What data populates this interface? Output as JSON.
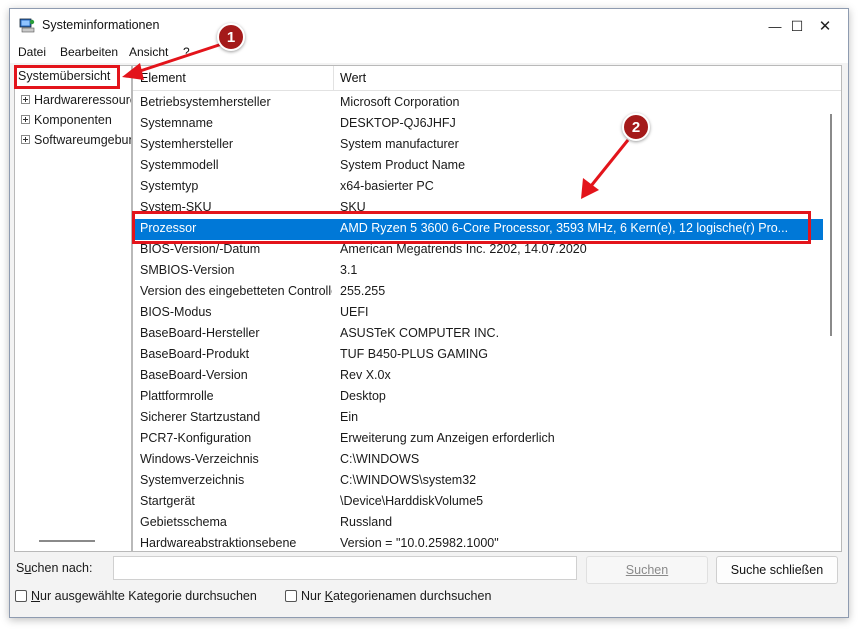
{
  "window": {
    "title": "Systeminformationen",
    "minimize_glyph": "—",
    "maximize_glyph": "☐",
    "close_glyph": "✕"
  },
  "menu": [
    "Datei",
    "Bearbeiten",
    "Ansicht",
    "?"
  ],
  "tree": {
    "root": "Systemübersicht",
    "children": [
      "Hardwareressourcen",
      "Komponenten",
      "Softwareumgebung"
    ]
  },
  "table": {
    "columns": [
      "Element",
      "Wert"
    ],
    "rows": [
      {
        "element": "Betriebsystemhersteller",
        "value": "Microsoft Corporation"
      },
      {
        "element": "Systemname",
        "value": "DESKTOP-QJ6JHFJ"
      },
      {
        "element": "Systemhersteller",
        "value": "System manufacturer"
      },
      {
        "element": "Systemmodell",
        "value": "System Product Name"
      },
      {
        "element": "Systemtyp",
        "value": "x64-basierter PC"
      },
      {
        "element": "System-SKU",
        "value": "SKU"
      },
      {
        "element": "Prozessor",
        "value": "AMD Ryzen 5 3600 6-Core Processor, 3593 MHz, 6 Kern(e), 12 logische(r) Pro..."
      },
      {
        "element": "BIOS-Version/-Datum",
        "value": "American Megatrends Inc. 2202, 14.07.2020"
      },
      {
        "element": "SMBIOS-Version",
        "value": "3.1"
      },
      {
        "element": "Version des eingebetteten Controllers",
        "value": "255.255"
      },
      {
        "element": "BIOS-Modus",
        "value": "UEFI"
      },
      {
        "element": "BaseBoard-Hersteller",
        "value": "ASUSTeK COMPUTER INC."
      },
      {
        "element": "BaseBoard-Produkt",
        "value": "TUF B450-PLUS GAMING"
      },
      {
        "element": "BaseBoard-Version",
        "value": "Rev X.0x"
      },
      {
        "element": "Plattformrolle",
        "value": "Desktop"
      },
      {
        "element": "Sicherer Startzustand",
        "value": "Ein"
      },
      {
        "element": "PCR7-Konfiguration",
        "value": "Erweiterung zum Anzeigen erforderlich"
      },
      {
        "element": "Windows-Verzeichnis",
        "value": "C:\\WINDOWS"
      },
      {
        "element": "Systemverzeichnis",
        "value": "C:\\WINDOWS\\system32"
      },
      {
        "element": "Startgerät",
        "value": "\\Device\\HarddiskVolume5"
      },
      {
        "element": "Gebietsschema",
        "value": "Russland"
      },
      {
        "element": "Hardwareabstraktionsebene",
        "value": "Version = \"10.0.25982.1000\""
      }
    ],
    "selected_index": 6
  },
  "search": {
    "label_pre": "S",
    "label_underlined": "u",
    "label_post": "chen nach:",
    "value": "",
    "search_button": "Suchen",
    "close_button": "Suche schließen",
    "check_selected_pre": "",
    "check_selected_underlined": "N",
    "check_selected_post": "ur ausgewählte Kategorie durchsuchen",
    "check_names_pre": "Nur ",
    "check_names_underlined": "K",
    "check_names_post": "ategorienamen durchsuchen"
  },
  "annotations": {
    "badge_1": "1",
    "badge_2": "2",
    "color": "#e3141b"
  },
  "colors": {
    "selection": "#0078d7",
    "annotation_red": "#e3141b",
    "badge_fill": "#a41a1a"
  }
}
